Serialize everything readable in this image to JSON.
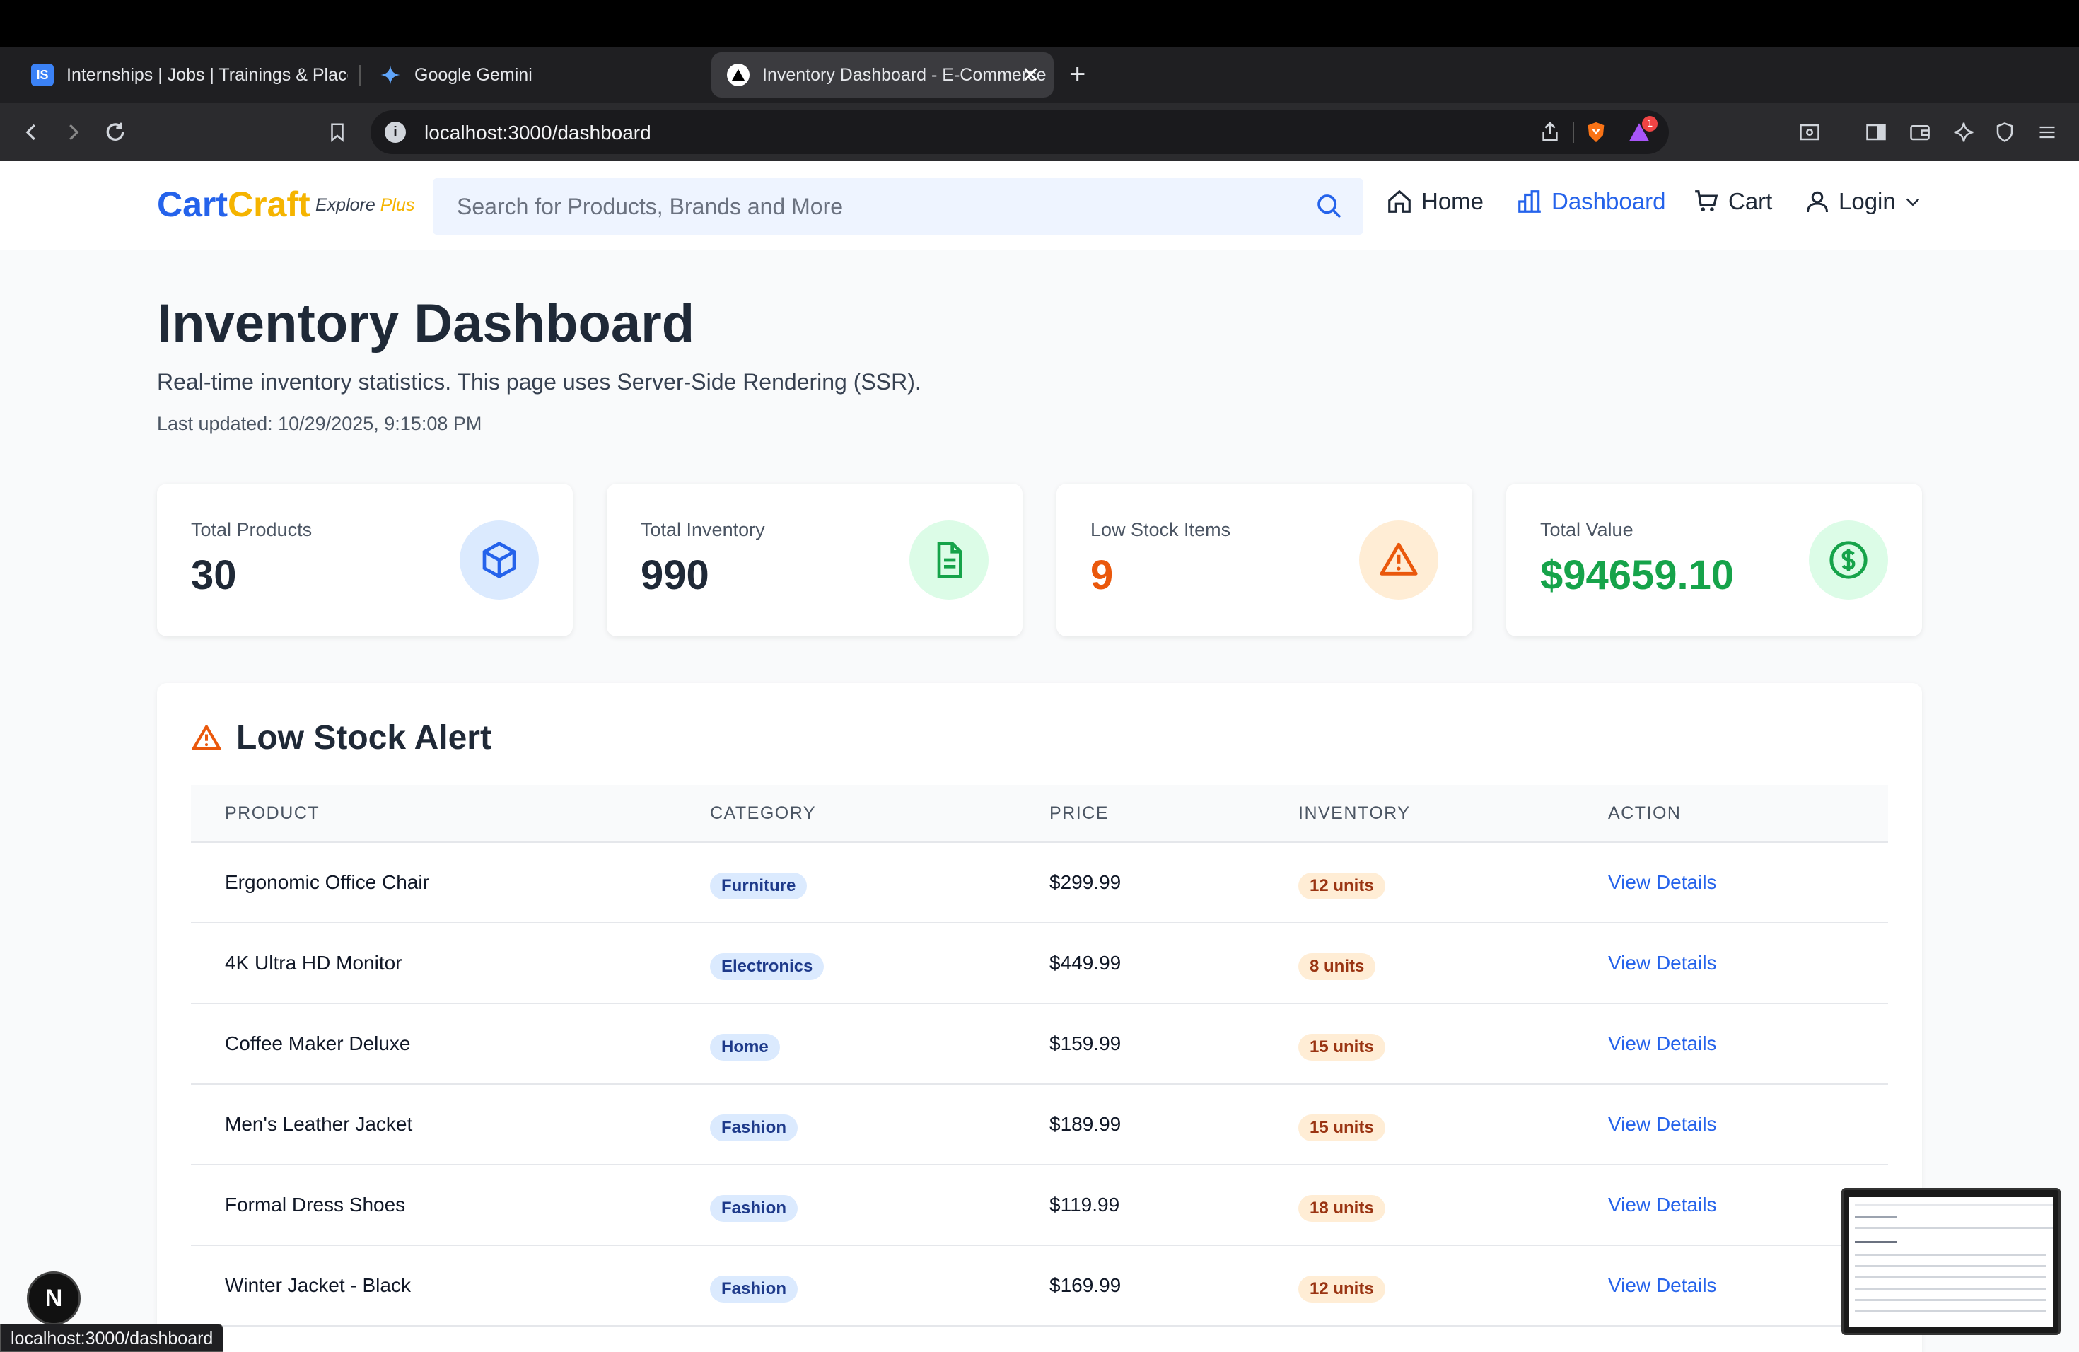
{
  "browser": {
    "tabs": [
      {
        "title": "Internships | Jobs | Trainings & Placements",
        "favicon": "IS"
      },
      {
        "title": "Google Gemini"
      },
      {
        "title": "Inventory Dashboard - E-Commerce"
      }
    ],
    "address": "localhost:3000/dashboard",
    "status_url": "localhost:3000/dashboard",
    "notification_count": "1"
  },
  "header": {
    "logo_cart": "Cart",
    "logo_craft": "Craft",
    "logo_sub_explore": "Explore",
    "logo_sub_plus": "Plus",
    "search_placeholder": "Search for Products, Brands and More",
    "nav": {
      "home": "Home",
      "dashboard": "Dashboard",
      "cart": "Cart",
      "login": "Login"
    }
  },
  "page": {
    "title": "Inventory Dashboard",
    "subtitle": "Real-time inventory statistics. This page uses Server-Side Rendering (SSR).",
    "updated": "Last updated: 10/29/2025, 9:15:08 PM"
  },
  "stats": [
    {
      "label": "Total Products",
      "value": "30",
      "icon": "cube-icon",
      "color": "#1f2937"
    },
    {
      "label": "Total Inventory",
      "value": "990",
      "icon": "document-icon",
      "color": "#1f2937"
    },
    {
      "label": "Low Stock Items",
      "value": "9",
      "icon": "warning-icon",
      "color": "#ea580c"
    },
    {
      "label": "Total Value",
      "value": "$94659.10",
      "icon": "dollar-icon",
      "color": "#16a34a"
    }
  ],
  "low_stock": {
    "title": "Low Stock Alert",
    "columns": [
      "PRODUCT",
      "CATEGORY",
      "PRICE",
      "INVENTORY",
      "ACTION"
    ],
    "rows": [
      {
        "product": "Ergonomic Office Chair",
        "category": "Furniture",
        "price": "$299.99",
        "inventory": "12 units",
        "action": "View Details"
      },
      {
        "product": "4K Ultra HD Monitor",
        "category": "Electronics",
        "price": "$449.99",
        "inventory": "8 units",
        "action": "View Details"
      },
      {
        "product": "Coffee Maker Deluxe",
        "category": "Home",
        "price": "$159.99",
        "inventory": "15 units",
        "action": "View Details"
      },
      {
        "product": "Men's Leather Jacket",
        "category": "Fashion",
        "price": "$189.99",
        "inventory": "15 units",
        "action": "View Details"
      },
      {
        "product": "Formal Dress Shoes",
        "category": "Fashion",
        "price": "$119.99",
        "inventory": "18 units",
        "action": "View Details"
      },
      {
        "product": "Winter Jacket - Black",
        "category": "Fashion",
        "price": "$169.99",
        "inventory": "12 units",
        "action": "View Details"
      }
    ]
  },
  "dev": {
    "badge": "N"
  },
  "colors": {
    "accent": "#2563eb",
    "brand_secondary": "#f5b400",
    "warning": "#ea580c",
    "success": "#16a34a"
  }
}
